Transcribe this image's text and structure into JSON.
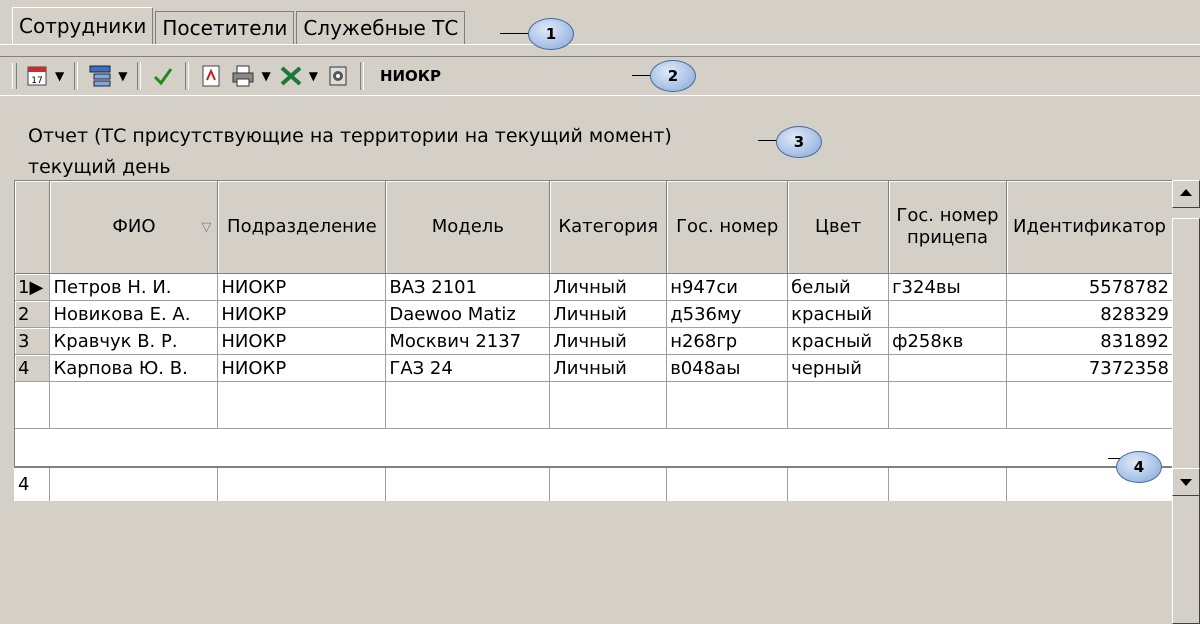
{
  "tabs": [
    {
      "label": "Сотрудники",
      "active": true
    },
    {
      "label": "Посетители",
      "active": false
    },
    {
      "label": "Служебные ТС",
      "active": false
    }
  ],
  "callouts": [
    "1",
    "2",
    "3",
    "4"
  ],
  "toolbar": {
    "label": "НИОКР",
    "icons": [
      "calendar-icon",
      "tree-view-icon",
      "checkmark-icon",
      "export-pdf-icon",
      "printer-icon",
      "excel-icon",
      "settings-icon"
    ]
  },
  "report": {
    "title": "Отчет (ТС присутствующие на территории на текущий момент)",
    "subtitle": "текущий день"
  },
  "grid": {
    "columns": [
      "ФИО",
      "Подразделение",
      "Модель",
      "Категория",
      "Гос. номер",
      "Цвет",
      "Гос. номер прицепа",
      "Идентификатор"
    ],
    "rows": [
      {
        "n": "1",
        "fio": "Петров Н. И.",
        "dept": "НИОКР",
        "model": "ВАЗ 2101",
        "cat": "Личный",
        "plate": "н947си",
        "color": "белый",
        "trailer": "г324вы",
        "id": "5578782"
      },
      {
        "n": "2",
        "fio": "Новикова Е. А.",
        "dept": "НИОКР",
        "model": "Daewoo Matiz",
        "cat": "Личный",
        "plate": "д536му",
        "color": "красный",
        "trailer": "",
        "id": "828329"
      },
      {
        "n": "3",
        "fio": "Кравчук В. Р.",
        "dept": "НИОКР",
        "model": "Москвич 2137",
        "cat": "Личный",
        "plate": "н268гр",
        "color": "красный",
        "trailer": "ф258кв",
        "id": "831892"
      },
      {
        "n": "4",
        "fio": "Карпова Ю. В.",
        "dept": "НИОКР",
        "model": "ГАЗ 24",
        "cat": "Личный",
        "plate": "в048аы",
        "color": "черный",
        "trailer": "",
        "id": "7372358"
      }
    ],
    "footer_count": "4"
  }
}
